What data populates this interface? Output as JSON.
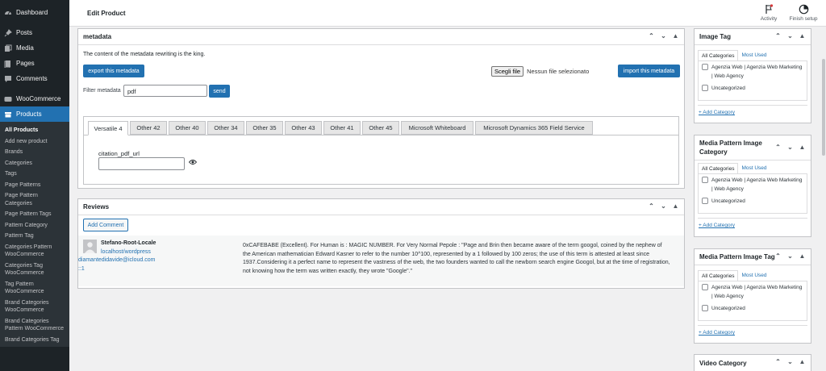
{
  "sidebar": {
    "dashboard": "Dashboard",
    "posts": "Posts",
    "media": "Media",
    "pages": "Pages",
    "comments": "Comments",
    "woocommerce": "WooCommerce",
    "products": "Products",
    "submenu": [
      "All Products",
      "Add new product",
      "Brands",
      "Categories",
      "Tags",
      "Page Patterns",
      "Page Pattern Categories",
      "Page Pattern Tags",
      "Pattern Category",
      "Pattern Tag",
      "Categories Pattern WooCommerce",
      "Categories Tag WooCommerce",
      "Tag Pattern WooCommerce",
      "Brand Categories WooCommerce",
      "Brand Categories Pattern WooCommerce",
      "Brand Categories Tag"
    ]
  },
  "topbar": {
    "title": "Edit Product",
    "activity": "Activity",
    "finish_setup": "Finish setup"
  },
  "metadata": {
    "title": "metadata",
    "description": "The content of the metadata rewriting is the king.",
    "export_label": "export this metadata",
    "choose_file": "Scegli file",
    "no_file": "Nessun file selezionato",
    "import_label": "import this metadata",
    "filter_label": "Filter metadata",
    "filter_value": "pdf",
    "send_label": "send",
    "tabs": [
      "Versatile 4",
      "Other 42",
      "Other 40",
      "Other 34",
      "Other 35",
      "Other 43",
      "Other 41",
      "Other 45",
      "Microsoft Whiteboard",
      "Microsoft Dynamics 365 Field Service"
    ],
    "field_label": "citation_pdf_url",
    "field_value": ""
  },
  "reviews": {
    "title": "Reviews",
    "add_comment": "Add Comment",
    "author": "Stefano-Root-Locale",
    "author_url": "localhost/wordpress",
    "author_email": "diamantedidavide@icloud.com",
    "author_ip": "::1",
    "comment": "0xCAFEBABE (Excellent). For Human is : MAGIC NUMBER. For Very Normal Pepole : \"Page and Brin then became aware of the term googol, coined by the nephew of the American mathematician Edward Kasner to refer to the number 10^100, represented by a 1 followed by 100 zeros; the use of this term is attested at least since 1937.Considering it a perfect name to represent the vastness of the web, the two founders wanted to call the newborn search engine Googol, but at the time of registration, not knowing how the term was written exactly, they wrote \"Google\".\""
  },
  "image_tag": {
    "title": "Image Tag",
    "all_categories": "All Categories",
    "most_used": "Most Used",
    "items": [
      "Agenzia Web | Agenzia Web Marketing | Web Agency",
      "Uncategorized"
    ],
    "add_category": "+ Add Category"
  },
  "media_pattern_cat": {
    "title": "Media Pattern Image Category",
    "all_categories": "All Categories",
    "most_used": "Most Used",
    "items": [
      "Agenzia Web | Agenzia Web Marketing | Web Agency",
      "Uncategorized"
    ],
    "add_category": "+ Add Category"
  },
  "media_pattern_tag": {
    "title": "Media Pattern Image Tag",
    "all_categories": "All Categories",
    "most_used": "Most Used",
    "items": [
      "Agenzia Web | Agenzia Web Marketing | Web Agency",
      "Uncategorized"
    ],
    "add_category": "+ Add Category"
  },
  "video_category": {
    "title": "Video Category"
  },
  "colors": {
    "sidebar_bg": "#1d2327",
    "accent": "#2271b1",
    "page_bg": "#f0f0f1"
  }
}
